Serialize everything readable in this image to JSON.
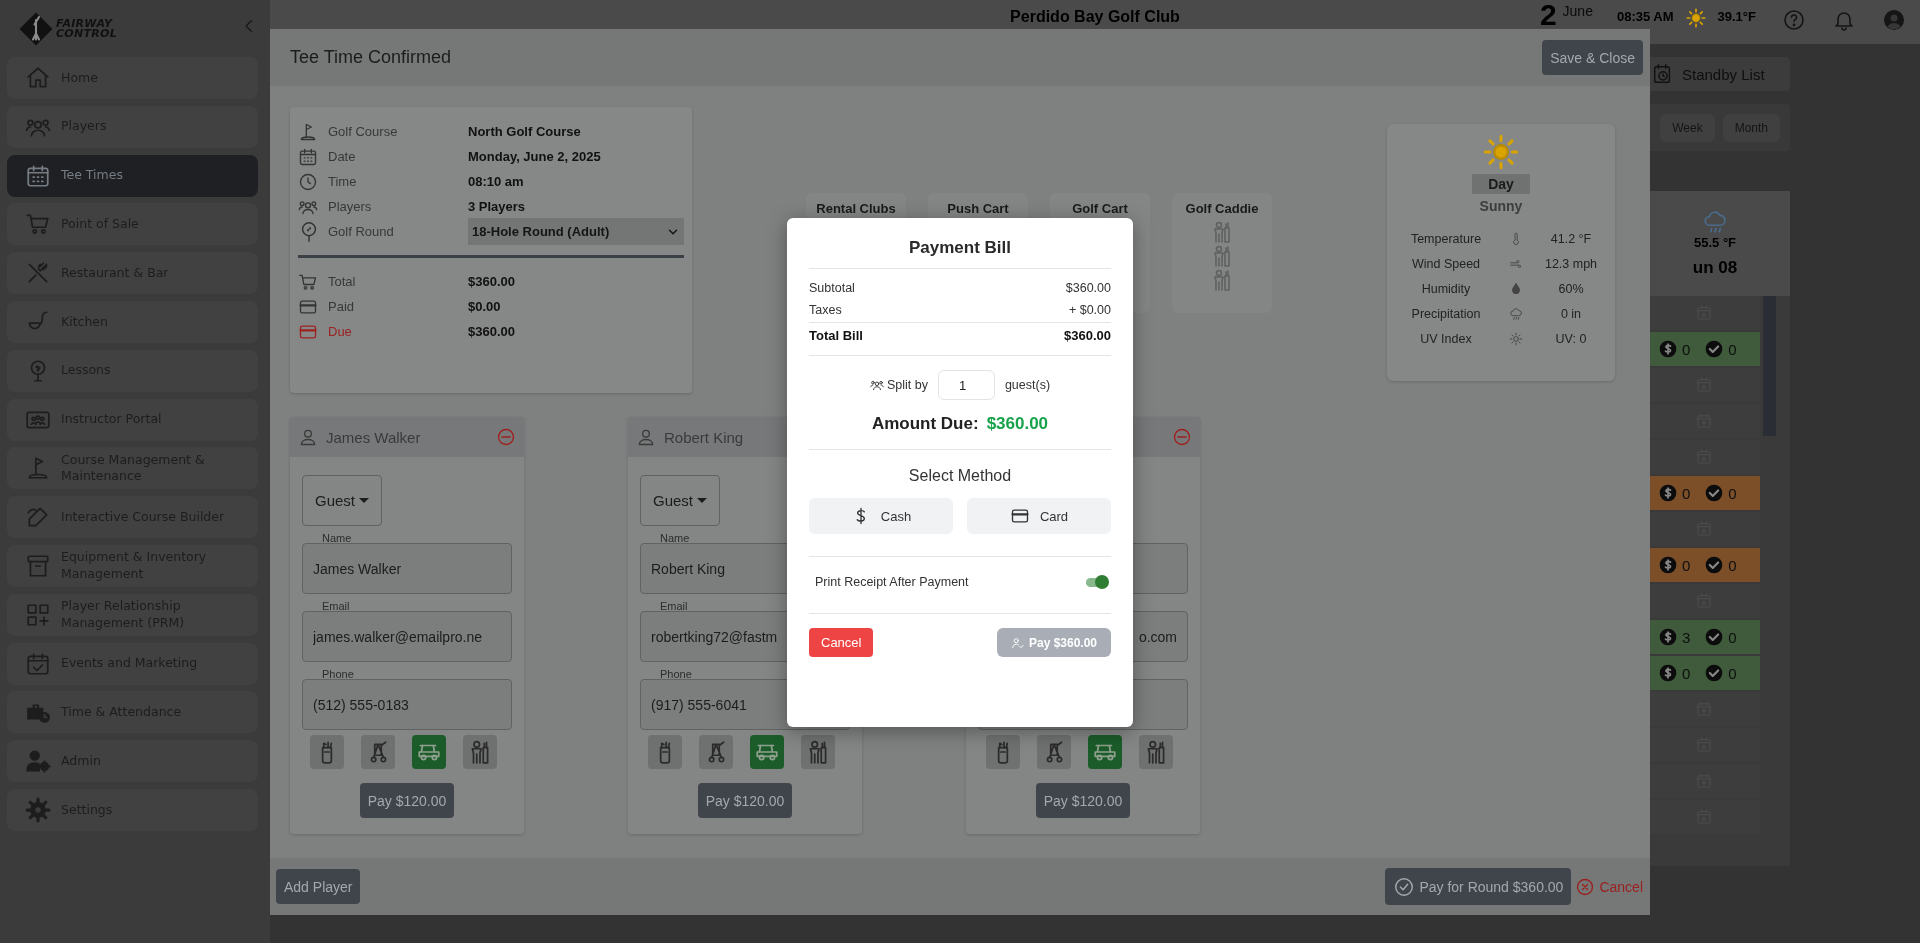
{
  "sidebar": {
    "logo_lines": [
      "FAIRWAY",
      "CONTROL"
    ],
    "items": [
      {
        "label": "Home",
        "selected": false
      },
      {
        "label": "Players",
        "selected": false
      },
      {
        "label": "Tee Times",
        "selected": true
      },
      {
        "label": "Point of Sale",
        "selected": false
      },
      {
        "label": "Restaurant & Bar",
        "selected": false
      },
      {
        "label": "Kitchen",
        "selected": false
      },
      {
        "label": "Lessons",
        "selected": false
      },
      {
        "label": "Instructor Portal",
        "selected": false
      },
      {
        "label": "Course Management & Maintenance",
        "selected": false
      },
      {
        "label": "Interactive Course Builder",
        "selected": false
      },
      {
        "label": "Equipment & Inventory Management",
        "selected": false
      },
      {
        "label": "Player Relationship Management (PRM)",
        "selected": false
      },
      {
        "label": "Events and Marketing",
        "selected": false
      },
      {
        "label": "Time & Attendance",
        "selected": false
      },
      {
        "label": "Admin",
        "selected": false
      },
      {
        "label": "Settings",
        "selected": false
      }
    ]
  },
  "header": {
    "title": "Perdido Bay Golf Club",
    "day": "2",
    "month": "June",
    "time": "08:35 AM",
    "temperature": "39.1°F"
  },
  "background": {
    "standby_label": "Standby List",
    "views": [
      "Week",
      "Month"
    ],
    "calendar": {
      "temperature": "55.5 °F",
      "day_label": "un 08",
      "slots": [
        {
          "kind": "empty"
        },
        {
          "kind": "booking",
          "color": "#3f5b3b",
          "paid": "0",
          "checked_in": "0"
        },
        {
          "kind": "empty"
        },
        {
          "kind": "empty"
        },
        {
          "kind": "empty"
        },
        {
          "kind": "booking",
          "color": "#7c4f28",
          "paid": "0",
          "checked_in": "0"
        },
        {
          "kind": "empty"
        },
        {
          "kind": "booking",
          "color": "#7c4f28",
          "paid": "0",
          "checked_in": "0"
        },
        {
          "kind": "empty"
        },
        {
          "kind": "booking",
          "color": "#3f5b3b",
          "paid": "3",
          "checked_in": "0"
        },
        {
          "kind": "booking",
          "color": "#3f5b3b",
          "paid": "0",
          "checked_in": "0"
        },
        {
          "kind": "empty"
        },
        {
          "kind": "empty"
        },
        {
          "kind": "empty"
        },
        {
          "kind": "empty"
        }
      ]
    }
  },
  "tee_time": {
    "title": "Tee Time Confirmed",
    "save_label": "Save & Close",
    "details": [
      {
        "label": "Golf Course",
        "value": "North Golf Course"
      },
      {
        "label": "Date",
        "value": "Monday, June 2, 2025"
      },
      {
        "label": "Time",
        "value": "08:10 am"
      },
      {
        "label": "Players",
        "value": "3 Players"
      }
    ],
    "golf_round": {
      "label": "Golf Round",
      "value": "18-Hole Round (Adult)"
    },
    "totals": [
      {
        "label": "Total",
        "value": "$360.00",
        "alert": false
      },
      {
        "label": "Paid",
        "value": "$0.00",
        "alert": false
      },
      {
        "label": "Due",
        "value": "$360.00",
        "alert": true
      }
    ],
    "equipment": [
      {
        "label": "Rental Clubs",
        "kind": "clubs"
      },
      {
        "label": "Push Cart",
        "kind": "push-cart"
      },
      {
        "label": "Golf Cart",
        "kind": "golf-cart"
      },
      {
        "label": "Golf Caddie",
        "kind": "caddie"
      }
    ],
    "weather": {
      "period": "Day",
      "condition": "Sunny",
      "rows": [
        {
          "label": "Temperature",
          "value": "41.2 °F"
        },
        {
          "label": "Wind Speed",
          "value": "12.3 mph"
        },
        {
          "label": "Humidity",
          "value": "60%"
        },
        {
          "label": "Precipitation",
          "value": "0 in"
        },
        {
          "label": "UV Index",
          "value": "UV: 0"
        }
      ]
    },
    "players": [
      {
        "name": "James Walker",
        "type": "Guest",
        "partial": false,
        "fields": {
          "name": {
            "label": "Name",
            "value": "James Walker"
          },
          "email": {
            "label": "Email",
            "value": "james.walker@emailpro.ne"
          },
          "phone": {
            "label": "Phone",
            "value": "(512) 555-0183"
          }
        },
        "equipment": [
          {
            "kind": "clubs",
            "selected": false
          },
          {
            "kind": "push-cart",
            "selected": false
          },
          {
            "kind": "golf-cart",
            "selected": true
          },
          {
            "kind": "caddie",
            "selected": false
          }
        ],
        "pay_label": "Pay $120.00"
      },
      {
        "name": "Robert King",
        "type": "Guest",
        "partial": false,
        "fields": {
          "name": {
            "label": "Name",
            "value": "Robert King"
          },
          "email": {
            "label": "Email",
            "value": "robertking72@fastm"
          },
          "phone": {
            "label": "Phone",
            "value": "(917) 555-6041"
          }
        },
        "equipment": [
          {
            "kind": "clubs",
            "selected": false
          },
          {
            "kind": "push-cart",
            "selected": false
          },
          {
            "kind": "golf-cart",
            "selected": true
          },
          {
            "kind": "caddie",
            "selected": false
          }
        ],
        "pay_label": "Pay $120.00"
      },
      {
        "partial": true,
        "fields": {
          "email": {
            "value": "o.com"
          }
        },
        "equipment": [
          {
            "kind": "clubs",
            "selected": false
          },
          {
            "kind": "push-cart",
            "selected": false
          },
          {
            "kind": "golf-cart",
            "selected": true
          },
          {
            "kind": "caddie",
            "selected": false
          }
        ],
        "pay_label": "Pay $120.00"
      }
    ],
    "add_label": "Add Player",
    "pay_round_label": "Pay for Round $360.00",
    "cancel_label": "Cancel"
  },
  "payment": {
    "title": "Payment Bill",
    "lines": [
      {
        "label": "Subtotal",
        "value": "$360.00"
      },
      {
        "label": "Taxes",
        "value": "+ $0.00"
      }
    ],
    "total": {
      "label": "Total Bill",
      "value": "$360.00"
    },
    "split": {
      "label": "Split by",
      "value": "1",
      "unit": "guest(s)"
    },
    "amount_due": {
      "label": "Amount Due:",
      "value": "$360.00"
    },
    "method_title": "Select Method",
    "methods": [
      {
        "kind": "cash",
        "label": "Cash"
      },
      {
        "kind": "card",
        "label": "Card"
      }
    ],
    "receipt": {
      "label": "Print Receipt After Payment",
      "on": true
    },
    "cancel_label": "Cancel",
    "pay": {
      "label": "Pay $360.00",
      "disabled": true
    }
  }
}
